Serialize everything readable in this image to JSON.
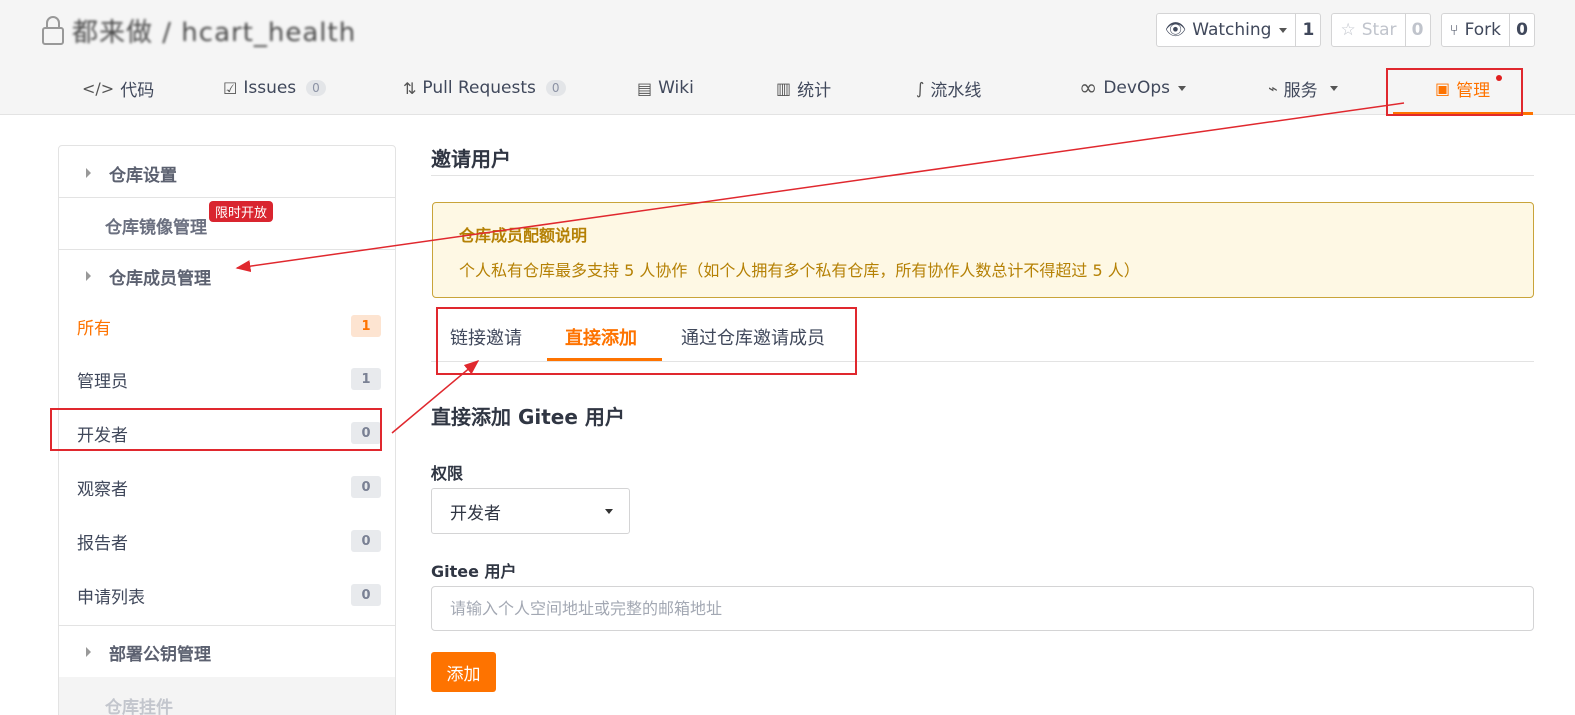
{
  "repo": {
    "name": "都来做 / hcart_health"
  },
  "actions": {
    "watch": {
      "label": "Watching",
      "count": "1"
    },
    "star": {
      "label": "Star",
      "count": "0"
    },
    "fork": {
      "label": "Fork",
      "count": "0"
    }
  },
  "nav": {
    "code": "代码",
    "issues": "Issues",
    "issues_count": "0",
    "pulls": "Pull Requests",
    "pulls_count": "0",
    "wiki": "Wiki",
    "stats": "统计",
    "pipeline": "流水线",
    "devops": "DevOps",
    "service": "服务",
    "manage": "管理"
  },
  "sidebar": {
    "repo_settings": "仓库设置",
    "mirror": "仓库镜像管理",
    "limit_badge": "限时开放",
    "members": "仓库成员管理",
    "items": [
      {
        "label": "所有",
        "count": "1"
      },
      {
        "label": "管理员",
        "count": "1"
      },
      {
        "label": "开发者",
        "count": "0"
      },
      {
        "label": "观察者",
        "count": "0"
      },
      {
        "label": "报告者",
        "count": "0"
      },
      {
        "label": "申请列表",
        "count": "0"
      }
    ],
    "deploy_keys": "部署公钥管理",
    "plugins": "仓库挂件"
  },
  "main": {
    "title": "邀请用户",
    "notice_title": "仓库成员配额说明",
    "notice_body": "个人私有仓库最多支持 5 人协作（如个人拥有多个私有仓库，所有协作人数总计不得超过 5 人）",
    "tabs": [
      "链接邀请",
      "直接添加",
      "通过仓库邀请成员"
    ],
    "sub_title": "直接添加 Gitee 用户",
    "perm_label": "权限",
    "perm_value": "开发者",
    "user_label": "Gitee 用户",
    "user_placeholder": "请输入个人空间地址或完整的邮箱地址",
    "add_button": "添加"
  },
  "colors": {
    "accent": "#fe7300",
    "annotation": "#e0282e",
    "notice_bg": "#fef8e4",
    "notice_text": "#b58105"
  }
}
